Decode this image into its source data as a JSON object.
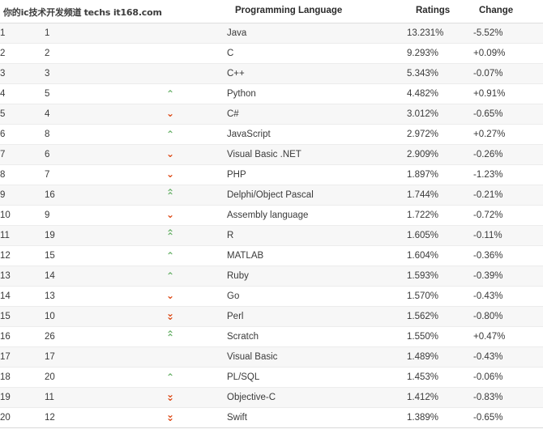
{
  "watermark": {
    "cn_text": "你的ic技术开发频道",
    "en_text": "techs it168.com"
  },
  "table": {
    "columns": [
      {
        "key": "rank_2019",
        "label": ""
      },
      {
        "key": "rank_2018",
        "label": ""
      },
      {
        "key": "arrow",
        "label": ""
      },
      {
        "key": "language",
        "label": "Programming Language"
      },
      {
        "key": "ratings",
        "label": "Ratings"
      },
      {
        "key": "change",
        "label": "Change"
      }
    ],
    "rows": [
      {
        "rank_2019": "1",
        "rank_2018": "1",
        "arrow": "none",
        "language": "Java",
        "ratings": "13.231%",
        "change": "-5.52%"
      },
      {
        "rank_2019": "2",
        "rank_2018": "2",
        "arrow": "none",
        "language": "C",
        "ratings": "9.293%",
        "change": "+0.09%"
      },
      {
        "rank_2019": "3",
        "rank_2018": "3",
        "arrow": "none",
        "language": "C++",
        "ratings": "5.343%",
        "change": "-0.07%"
      },
      {
        "rank_2019": "4",
        "rank_2018": "5",
        "arrow": "up",
        "language": "Python",
        "ratings": "4.482%",
        "change": "+0.91%"
      },
      {
        "rank_2019": "5",
        "rank_2018": "4",
        "arrow": "down",
        "language": "C#",
        "ratings": "3.012%",
        "change": "-0.65%"
      },
      {
        "rank_2019": "6",
        "rank_2018": "8",
        "arrow": "up",
        "language": "JavaScript",
        "ratings": "2.972%",
        "change": "+0.27%"
      },
      {
        "rank_2019": "7",
        "rank_2018": "6",
        "arrow": "down",
        "language": "Visual Basic .NET",
        "ratings": "2.909%",
        "change": "-0.26%"
      },
      {
        "rank_2019": "8",
        "rank_2018": "7",
        "arrow": "down",
        "language": "PHP",
        "ratings": "1.897%",
        "change": "-1.23%"
      },
      {
        "rank_2019": "9",
        "rank_2018": "16",
        "arrow": "double-up",
        "language": "Delphi/Object Pascal",
        "ratings": "1.744%",
        "change": "-0.21%"
      },
      {
        "rank_2019": "10",
        "rank_2018": "9",
        "arrow": "down",
        "language": "Assembly language",
        "ratings": "1.722%",
        "change": "-0.72%"
      },
      {
        "rank_2019": "11",
        "rank_2018": "19",
        "arrow": "double-up",
        "language": "R",
        "ratings": "1.605%",
        "change": "-0.11%"
      },
      {
        "rank_2019": "12",
        "rank_2018": "15",
        "arrow": "up",
        "language": "MATLAB",
        "ratings": "1.604%",
        "change": "-0.36%"
      },
      {
        "rank_2019": "13",
        "rank_2018": "14",
        "arrow": "up",
        "language": "Ruby",
        "ratings": "1.593%",
        "change": "-0.39%"
      },
      {
        "rank_2019": "14",
        "rank_2018": "13",
        "arrow": "down",
        "language": "Go",
        "ratings": "1.570%",
        "change": "-0.43%"
      },
      {
        "rank_2019": "15",
        "rank_2018": "10",
        "arrow": "double-down",
        "language": "Perl",
        "ratings": "1.562%",
        "change": "-0.80%"
      },
      {
        "rank_2019": "16",
        "rank_2018": "26",
        "arrow": "double-up",
        "language": "Scratch",
        "ratings": "1.550%",
        "change": "+0.47%"
      },
      {
        "rank_2019": "17",
        "rank_2018": "17",
        "arrow": "none",
        "language": "Visual Basic",
        "ratings": "1.489%",
        "change": "-0.43%"
      },
      {
        "rank_2019": "18",
        "rank_2018": "20",
        "arrow": "up",
        "language": "PL/SQL",
        "ratings": "1.453%",
        "change": "-0.06%"
      },
      {
        "rank_2019": "19",
        "rank_2018": "11",
        "arrow": "double-down",
        "language": "Objective-C",
        "ratings": "1.412%",
        "change": "-0.83%"
      },
      {
        "rank_2019": "20",
        "rank_2018": "12",
        "arrow": "double-down",
        "language": "Swift",
        "ratings": "1.389%",
        "change": "-0.65%"
      }
    ]
  },
  "colors": {
    "arrow_up": "#6cb36c",
    "arrow_down": "#dd4814",
    "row_stripe": "#f7f7f7",
    "text": "#3a3a3a"
  }
}
